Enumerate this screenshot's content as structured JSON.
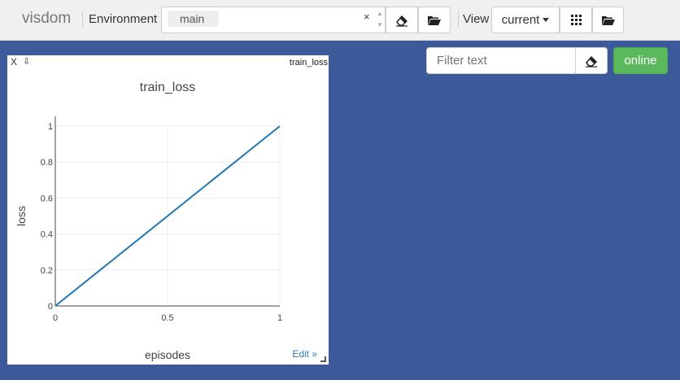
{
  "app": {
    "brand": "visdom"
  },
  "toolbar": {
    "environment_label": "Environment",
    "env_selected": "main",
    "env_clear": "×",
    "view_label": "View",
    "view_selected": "current"
  },
  "filter": {
    "placeholder": "Filter text"
  },
  "status": {
    "label": "online",
    "color": "#5cb85c"
  },
  "pane": {
    "close": "X",
    "download": "⇩",
    "title": "train_loss",
    "edit": "Edit »"
  },
  "chart_data": {
    "type": "line",
    "title": "train_loss",
    "xlabel": "episodes",
    "ylabel": "loss",
    "xlim": [
      0,
      1
    ],
    "ylim": [
      0,
      1
    ],
    "xticks": [
      0,
      0.5,
      1
    ],
    "yticks": [
      0,
      0.2,
      0.4,
      0.6,
      0.8,
      1
    ],
    "grid": true,
    "series": [
      {
        "x": [
          0,
          1
        ],
        "y": [
          0,
          1
        ],
        "color": "#1f77b4"
      }
    ]
  }
}
